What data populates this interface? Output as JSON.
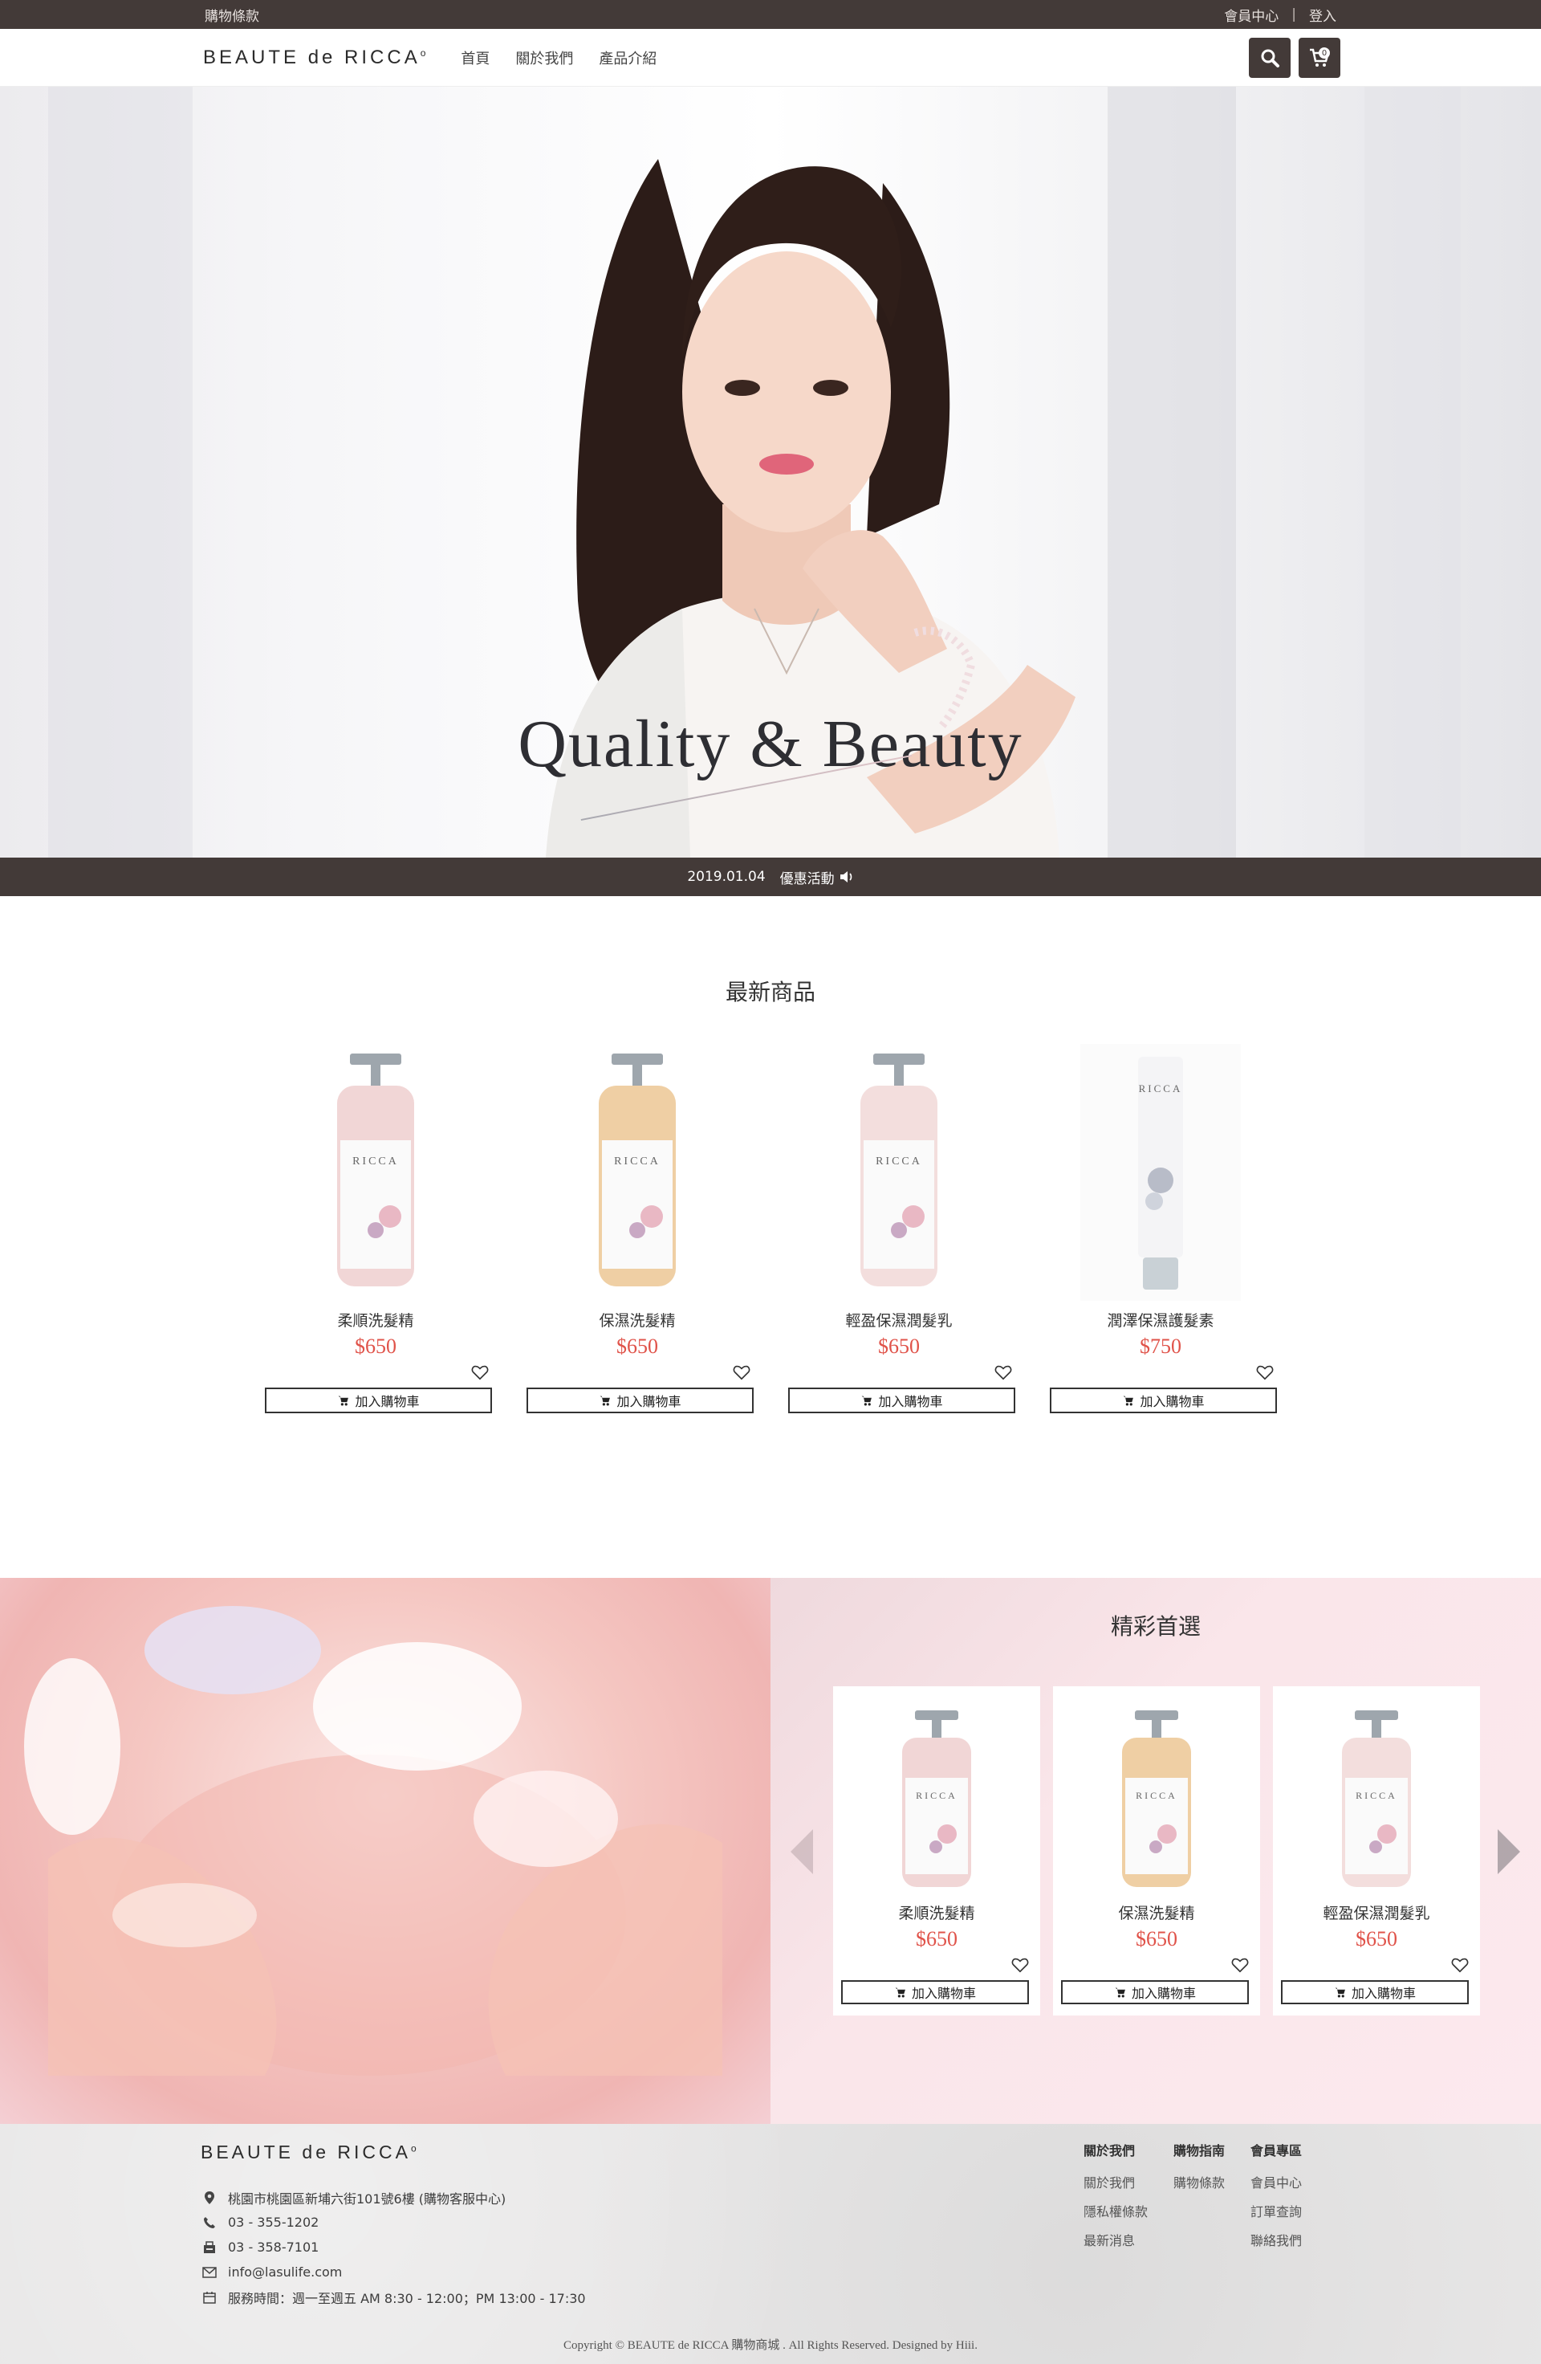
{
  "topbar": {
    "left_link": "購物條款",
    "member_center": "會員中心",
    "separator": "|",
    "login": "登入"
  },
  "header": {
    "logo": "BEAUTE de RICCA",
    "nav": [
      "首頁",
      "關於我們",
      "產品介紹"
    ],
    "cart_count": "0",
    "icons": {
      "search": "search-icon",
      "cart": "cart-icon"
    }
  },
  "hero": {
    "title": "Quality & Beauty"
  },
  "news": {
    "date": "2019.01.04",
    "text": "優惠活動"
  },
  "newest": {
    "title": "最新商品",
    "products": [
      {
        "name": "柔順洗髮精",
        "price": "$650",
        "add_label": "加入購物車"
      },
      {
        "name": "保濕洗髮精",
        "price": "$650",
        "add_label": "加入購物車"
      },
      {
        "name": "輕盈保濕潤髮乳",
        "price": "$650",
        "add_label": "加入購物車"
      },
      {
        "name": "潤澤保濕護髮素",
        "price": "$750",
        "add_label": "加入購物車"
      }
    ]
  },
  "featured": {
    "title": "精彩首選",
    "products": [
      {
        "name": "柔順洗髮精",
        "price": "$650",
        "add_label": "加入購物車"
      },
      {
        "name": "保濕洗髮精",
        "price": "$650",
        "add_label": "加入購物車"
      },
      {
        "name": "輕盈保濕潤髮乳",
        "price": "$650",
        "add_label": "加入購物車"
      }
    ]
  },
  "footer": {
    "logo": "BEAUTE de RICCA",
    "address": "桃園市桃園區新埔六街101號6樓 (購物客服中心)",
    "phone": "03 - 355-1202",
    "fax": "03 - 358-7101",
    "email": "info@lasulife.com",
    "hours": "服務時間：週一至週五 AM 8:30 - 12:00；PM 13:00 - 17:30",
    "columns": [
      {
        "head": "關於我們",
        "links": [
          "關於我們",
          "隱私權條款",
          "最新消息"
        ]
      },
      {
        "head": "購物指南",
        "links": [
          "購物條款"
        ]
      },
      {
        "head": "會員專區",
        "links": [
          "會員中心",
          "訂單查詢",
          "聯絡我們"
        ]
      }
    ],
    "copyright": "Copyright © BEAUTE de RICCA 購物商城 . All Rights Reserved. Designed by Hiii."
  },
  "colors": {
    "dark": "#433a38",
    "price": "#e0534a",
    "featured_bg": "#fce9ee"
  }
}
